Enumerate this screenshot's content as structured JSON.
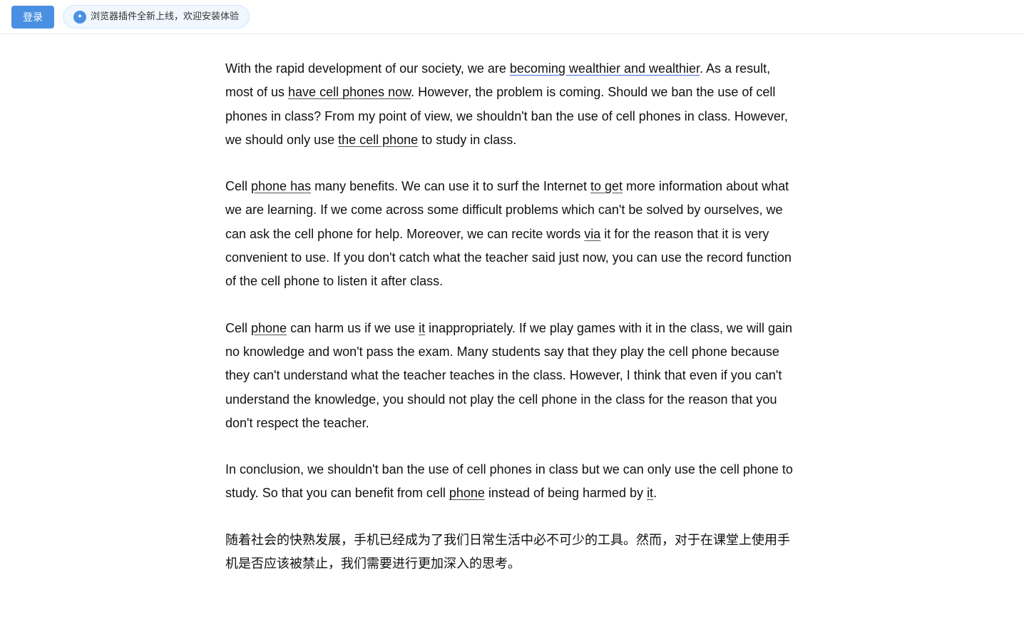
{
  "topbar": {
    "login_label": "登录",
    "plugin_notice": "浏览器插件全新上线，欢迎安装体验"
  },
  "paragraphs": [
    {
      "id": "p1",
      "html": "With the rapid development of our society, we are <span class=\"underline-blue\">becoming wealthier and wealthier</span>. As a result, most of us <span class=\"underline-single\">have cell phones now</span>. However, the problem is coming. Should we ban the use of cell phones in class? From my point of view, we shouldn't ban the use of cell phones in class. However, we should only use <span class=\"underline-single\">the cell phone</span> to study in class."
    },
    {
      "id": "p2",
      "html": "Cell <span class=\"underline-single\">phone has</span> many benefits. We can use it to surf the Internet <span class=\"underline-single\">to get</span> more information about what we are learning. If we come across some difficult problems which can't be solved by ourselves, we can ask the cell phone for help. Moreover, we can recite words <span class=\"underline-single\">via</span> it for the reason that it is very convenient to use. If you don't catch what the teacher said just now, you can use the record function of the cell phone to listen it after class."
    },
    {
      "id": "p3",
      "html": "Cell <span class=\"underline-single\">phone</span> can harm us if we use <span class=\"underline-single\">it</span> inappropriately. If we play games with it in the class, we will gain no knowledge and won't pass the exam. Many students say that they play the cell phone because they can't understand what the teacher teaches in the class. However, I think that even if you can't understand the knowledge, you should not play the cell phone in the class for the reason that you don't respect the teacher."
    },
    {
      "id": "p4",
      "html": "In conclusion, we shouldn't ban the use of cell phones in class but we can only use the cell phone to study. So that you can benefit from cell <span class=\"underline-single\">phone</span> instead of being harmed by <span class=\"underline-single\">it</span>."
    },
    {
      "id": "p5",
      "html": "随着社会的快熟发展，手机已经成为了我们日常生活中必不可少的工具。然而，对于在课堂上使用手机是否应该被禁止，我们需要进行更加深入的思考。"
    }
  ]
}
